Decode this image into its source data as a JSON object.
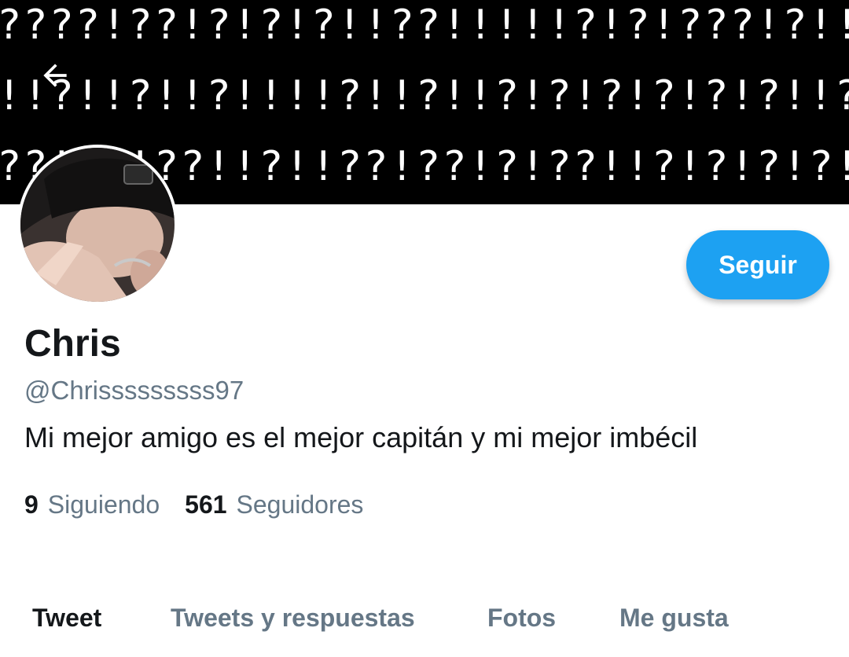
{
  "banner": {
    "lines": [
      "????!??!?!?!?!!??!!!!!?!?!???!?!!!!!?!??!?",
      "!!?!!?!!?!!!!?!!?!!?!?!?!?!?!?!!?!?!!!?!!?!?!",
      "??!??!??!!?!!??!??!?!??!!?!?!?!?!!?!?!?!!!!"
    ]
  },
  "header": {
    "back_icon": "arrow-left-icon"
  },
  "profile": {
    "name": "Chris",
    "handle": "@Chrisssssssss97",
    "bio": "Mi mejor amigo es el mejor capitán y mi mejor imbécil",
    "follow_label": "Seguir",
    "following_count": "9",
    "following_label": "Siguiendo",
    "followers_count": "561",
    "followers_label": "Seguidores"
  },
  "tabs": [
    {
      "label": "Tweet",
      "active": true
    },
    {
      "label": "Tweets y respuestas",
      "active": false
    },
    {
      "label": "Fotos",
      "active": false
    },
    {
      "label": "Me gusta",
      "active": false
    }
  ],
  "colors": {
    "accent": "#1da1f2",
    "text_primary": "#14171a",
    "text_secondary": "#657786",
    "banner_bg": "#000000"
  }
}
